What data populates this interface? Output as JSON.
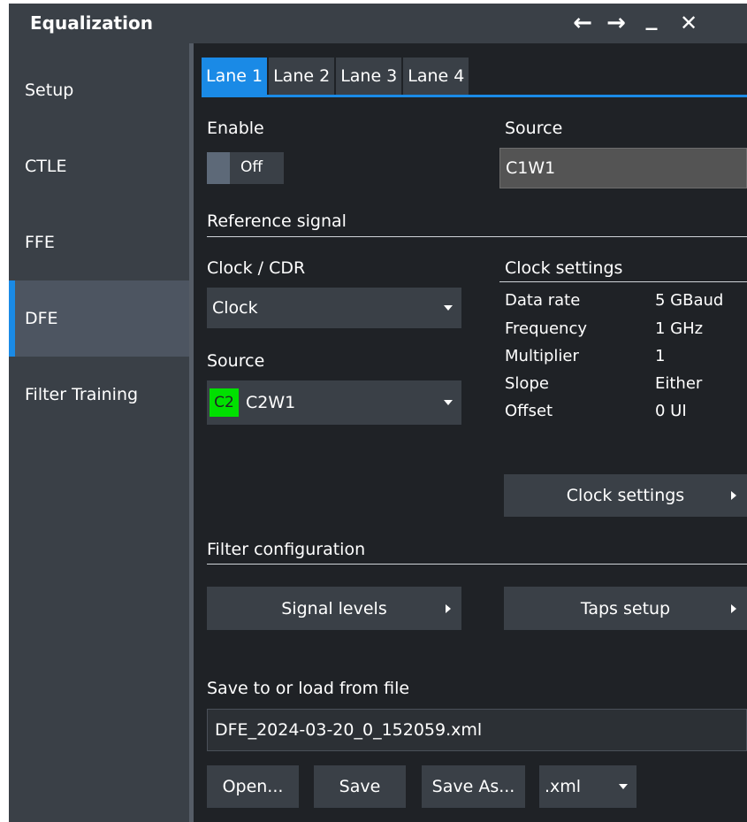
{
  "window": {
    "title": "Equalization",
    "controls": [
      "←",
      "→",
      "_",
      "✕"
    ]
  },
  "sidebar": {
    "items": [
      {
        "label": "Setup"
      },
      {
        "label": "CTLE"
      },
      {
        "label": "FFE"
      },
      {
        "label": "DFE",
        "active": true
      },
      {
        "label": "Filter Training"
      }
    ]
  },
  "tabs": [
    {
      "label": "Lane 1",
      "active": true
    },
    {
      "label": "Lane 2"
    },
    {
      "label": "Lane 3"
    },
    {
      "label": "Lane 4"
    }
  ],
  "enable": {
    "label": "Enable",
    "value": "Off"
  },
  "source": {
    "label": "Source",
    "value": "C1W1"
  },
  "reference_signal": {
    "section_label": "Reference signal",
    "clock_cdr_label": "Clock / CDR",
    "clock_cdr_value": "Clock",
    "source_label": "Source",
    "source_badge": "C2",
    "source_value": "C2W1",
    "clock_settings_header": "Clock settings",
    "settings": [
      {
        "key": "Data rate",
        "value": "5 GBaud"
      },
      {
        "key": "Frequency",
        "value": "1 GHz"
      },
      {
        "key": "Multiplier",
        "value": "1"
      },
      {
        "key": "Slope",
        "value": "Either"
      },
      {
        "key": "Offset",
        "value": "0 UI"
      }
    ],
    "clock_settings_button": "Clock settings"
  },
  "filter_configuration": {
    "section_label": "Filter configuration",
    "signal_levels_button": "Signal levels",
    "taps_setup_button": "Taps setup"
  },
  "file": {
    "label": "Save to or load from file",
    "path": "DFE_2024-03-20_0_152059.xml",
    "open_button": "Open...",
    "save_button": "Save",
    "save_as_button": "Save As...",
    "extension": ".xml"
  },
  "colors": {
    "accent": "#1a8ae6",
    "badge_green": "#00e000",
    "panel": "#3a4047",
    "background": "#1f2226"
  }
}
